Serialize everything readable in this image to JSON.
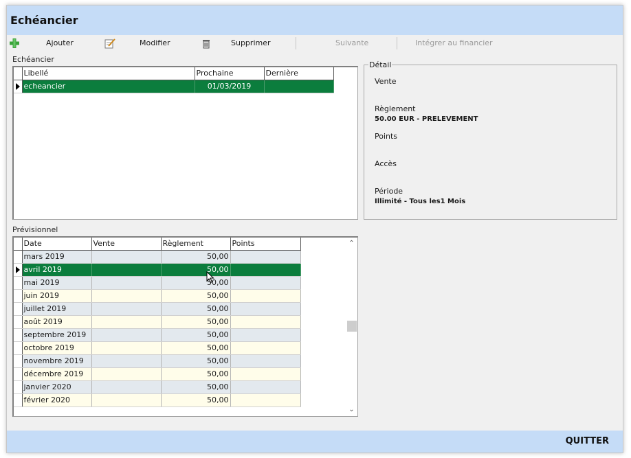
{
  "window": {
    "title": "Echéancier"
  },
  "toolbar": {
    "add_label": "Ajouter",
    "modify_label": "Modifier",
    "delete_label": "Supprimer",
    "next_label": "Suivante",
    "integrate_label": "Intégrer au financier"
  },
  "schedule": {
    "label": "Echéancier",
    "columns": [
      "Libellé",
      "Prochaine",
      "Dernière"
    ],
    "rows": [
      {
        "libelle": "echeancier",
        "prochaine": "01/03/2019",
        "derniere": ""
      }
    ]
  },
  "detail": {
    "legend": "Détail",
    "vente_label": "Vente",
    "vente_value": "",
    "reglement_label": "Règlement",
    "reglement_value": "50.00 EUR - PRELEVEMENT",
    "points_label": "Points",
    "points_value": "",
    "acces_label": "Accès",
    "acces_value": "",
    "periode_label": "Période",
    "periode_value": "Illimité - Tous les1 Mois"
  },
  "forecast": {
    "label": "Prévisionnel",
    "columns": [
      "Date",
      "Vente",
      "Règlement",
      "Points"
    ],
    "rows": [
      {
        "date": "mars 2019",
        "vente": "",
        "reglement": "50,00",
        "points": ""
      },
      {
        "date": "avril 2019",
        "vente": "",
        "reglement": "50,00",
        "points": ""
      },
      {
        "date": "mai 2019",
        "vente": "",
        "reglement": "50,00",
        "points": ""
      },
      {
        "date": "juin 2019",
        "vente": "",
        "reglement": "50,00",
        "points": ""
      },
      {
        "date": "juillet 2019",
        "vente": "",
        "reglement": "50,00",
        "points": ""
      },
      {
        "date": "août 2019",
        "vente": "",
        "reglement": "50,00",
        "points": ""
      },
      {
        "date": "septembre 2019",
        "vente": "",
        "reglement": "50,00",
        "points": ""
      },
      {
        "date": "octobre 2019",
        "vente": "",
        "reglement": "50,00",
        "points": ""
      },
      {
        "date": "novembre 2019",
        "vente": "",
        "reglement": "50,00",
        "points": ""
      },
      {
        "date": "décembre 2019",
        "vente": "",
        "reglement": "50,00",
        "points": ""
      },
      {
        "date": "janvier 2020",
        "vente": "",
        "reglement": "50,00",
        "points": ""
      },
      {
        "date": "février 2020",
        "vente": "",
        "reglement": "50,00",
        "points": ""
      }
    ]
  },
  "footer": {
    "quit_label": "QUITTER"
  },
  "colors": {
    "header": "#c5dcf7",
    "selection": "#0b7d3d",
    "row_odd": "#e3e9ee",
    "row_even": "#fffdea"
  },
  "icons": {
    "add": "plus-icon",
    "modify": "edit-icon",
    "delete": "trash-icon"
  }
}
